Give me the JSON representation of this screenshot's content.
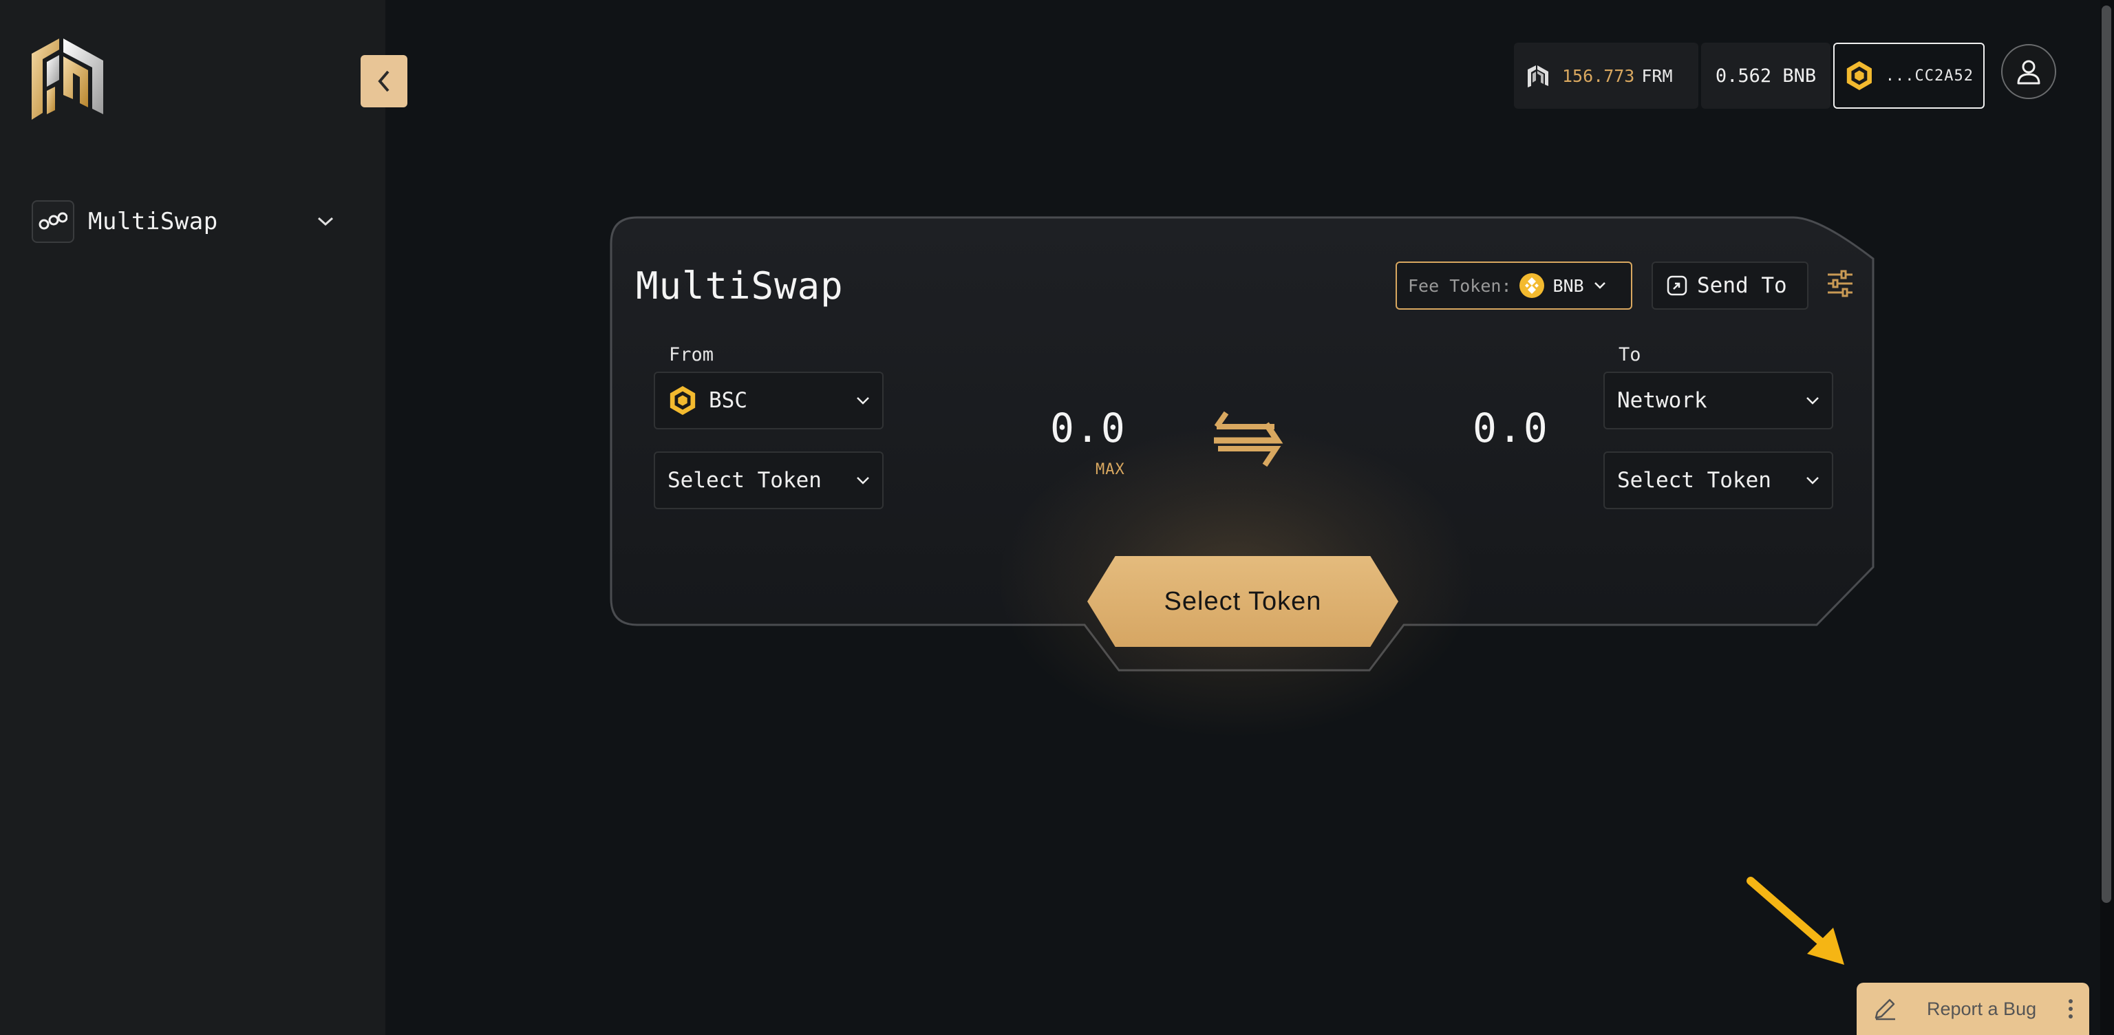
{
  "colors": {
    "accent": "#e8c596",
    "gold": "#d9a860",
    "bnb": "#f3ba2f",
    "bg": "#101316",
    "sidebar": "#1a1c1e"
  },
  "sidebar": {
    "logo_icon": "frm-logo",
    "collapse_icon": "chevron-left-icon",
    "items": [
      {
        "label": "MultiSwap",
        "icon": "multiswap-icon"
      }
    ]
  },
  "header": {
    "frm_amount": "156.773",
    "frm_unit": "FRM",
    "bnb_balance": "0.562 BNB",
    "wallet_address": "...CC2A52"
  },
  "card": {
    "title": "MultiSwap",
    "fee_token_label": "Fee Token:",
    "fee_token_value": "BNB",
    "send_to_label": "Send To",
    "from_label": "From",
    "from_network": "BSC",
    "from_token_placeholder": "Select Token",
    "from_amount": "0.0",
    "max_label": "MAX",
    "to_label": "To",
    "to_network": "Network",
    "to_token_placeholder": "Select Token",
    "to_amount": "0.0",
    "cta_label": "Select Token"
  },
  "report_bug": {
    "label": "Report a Bug"
  }
}
